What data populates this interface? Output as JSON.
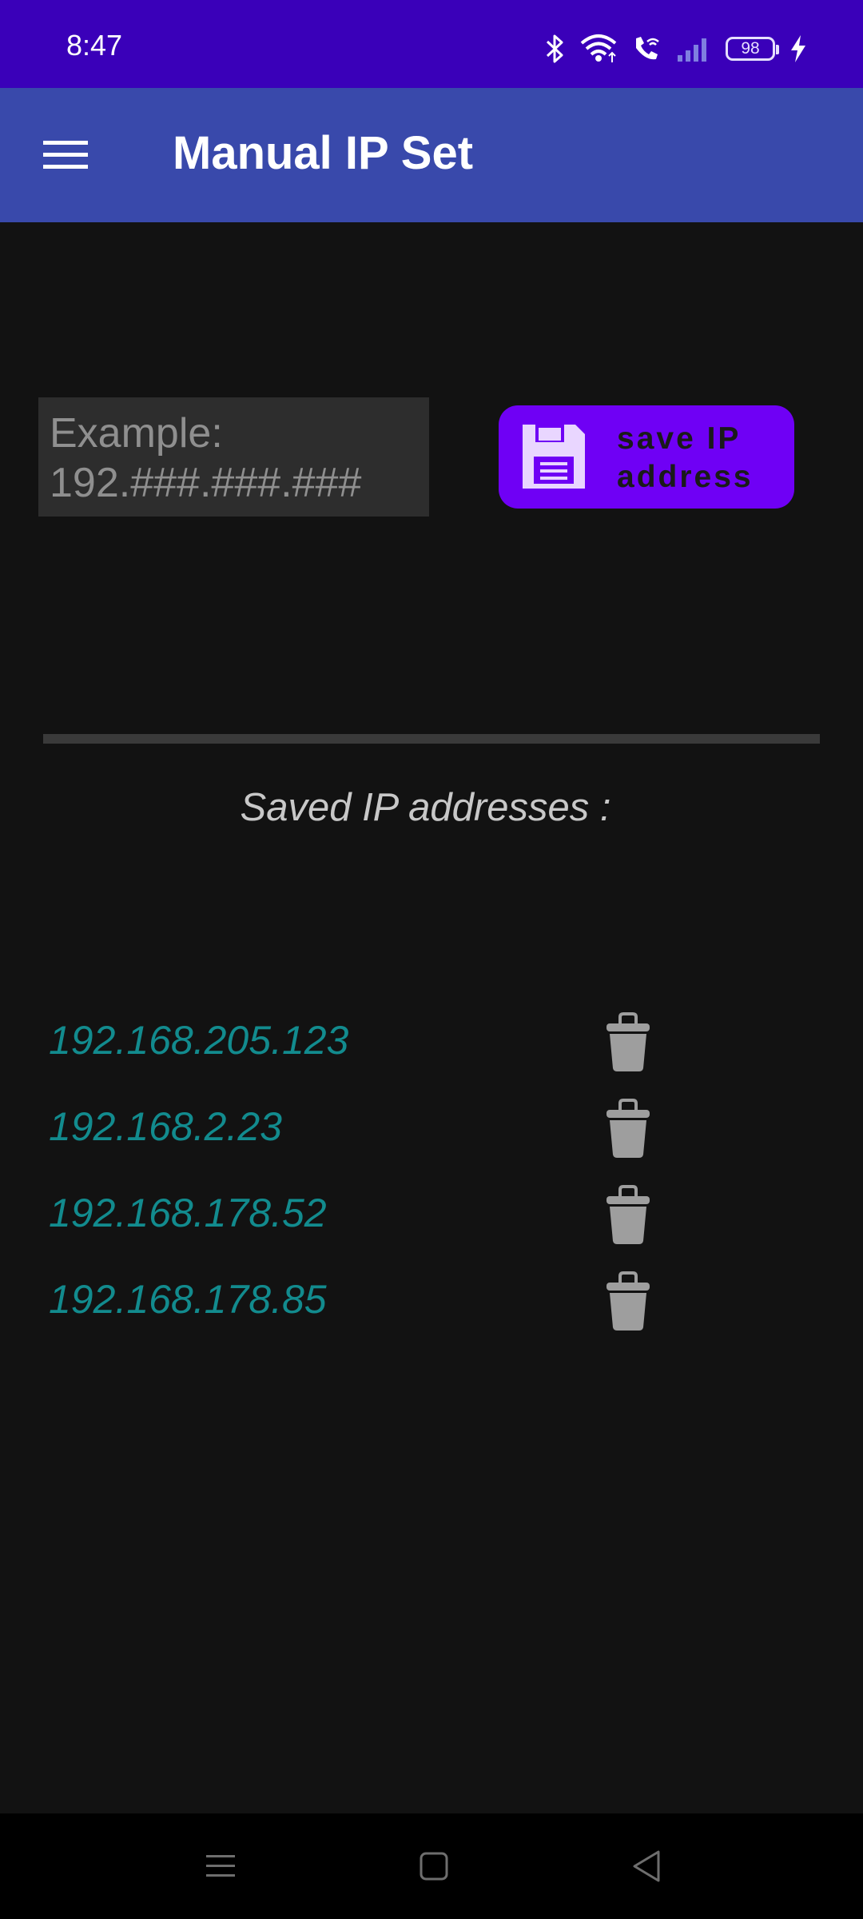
{
  "status_bar": {
    "time": "8:47",
    "battery_level": "98",
    "icons": [
      "bluetooth-icon",
      "wifi-icon",
      "wifi-calling-icon",
      "signal-icon",
      "battery-icon",
      "charging-icon"
    ]
  },
  "app_bar": {
    "title": "Manual IP Set",
    "menu_icon": "hamburger-menu-icon"
  },
  "ip_input": {
    "value": "",
    "placeholder": "Example: 192.###.###.###"
  },
  "save_button": {
    "label": "save IP address",
    "icon": "floppy-disk-icon"
  },
  "saved_section": {
    "heading": "Saved IP addresses :",
    "items": [
      {
        "ip": "192.168.205.123",
        "delete_icon": "trash-icon"
      },
      {
        "ip": "192.168.2.23",
        "delete_icon": "trash-icon"
      },
      {
        "ip": "192.168.178.52",
        "delete_icon": "trash-icon"
      },
      {
        "ip": "192.168.178.85",
        "delete_icon": "trash-icon"
      }
    ]
  },
  "nav_bar": {
    "buttons": [
      "recents-icon",
      "home-icon",
      "back-icon"
    ]
  },
  "colors": {
    "status_bar": "#3a00b9",
    "app_bar": "#3949ab",
    "background": "#121212",
    "save_button": "#6f00f5",
    "ip_text": "#128b8e",
    "trash_icon": "#9e9e9e"
  }
}
